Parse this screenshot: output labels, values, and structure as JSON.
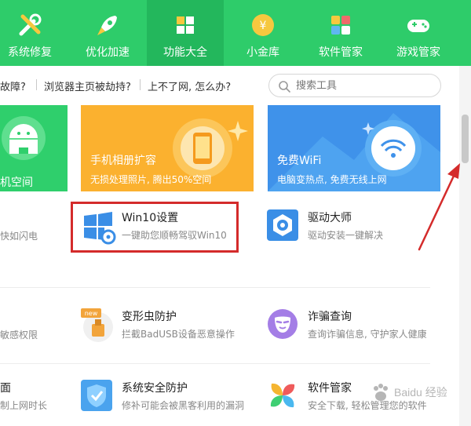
{
  "nav": {
    "items": [
      {
        "label": "系统修复",
        "icon": "tools-icon"
      },
      {
        "label": "优化加速",
        "icon": "rocket-icon"
      },
      {
        "label": "功能大全",
        "icon": "grid-icon"
      },
      {
        "label": "小金库",
        "icon": "coin-icon"
      },
      {
        "label": "软件管家",
        "icon": "app-store-icon"
      },
      {
        "label": "游戏管家",
        "icon": "gamepad-icon"
      }
    ],
    "active_index": 2
  },
  "hotlinks": [
    "故障?",
    "浏览器主页被劫持?",
    "上不了网, 怎么办?"
  ],
  "search": {
    "placeholder": "搜索工具"
  },
  "banners": [
    {
      "title": "机空间",
      "subtitle": "",
      "icon": "android-icon"
    },
    {
      "title": "手机相册扩容",
      "subtitle": "无损处理照片, 腾出50%空间",
      "icon": "phone-icon"
    },
    {
      "title": "免费WiFi",
      "subtitle": "电脑变热点, 免费无线上网",
      "icon": "wifi-icon"
    }
  ],
  "rows": {
    "row1": {
      "left_cut_desc": "快如闪电",
      "col2": {
        "title": "Win10设置",
        "desc": "一键助您顺畅驾驭Win10",
        "icon": "windows-settings-icon"
      },
      "col3": {
        "title": "驱动大师",
        "desc": "驱动安装一键解决",
        "icon": "driver-gear-icon"
      }
    },
    "row2": {
      "left_cut_desc": "敏感权限",
      "col2": {
        "title": "变形虫防护",
        "desc": "拦截BadUSB设备恶意操作",
        "icon": "usb-shield-icon",
        "badge": "new"
      },
      "col3": {
        "title": "诈骗查询",
        "desc": "查询诈骗信息, 守护家人健康",
        "icon": "mask-icon"
      }
    },
    "row3": {
      "left_cut_title": "面",
      "left_cut_desc": "制上网时长",
      "col2": {
        "title": "系统安全防护",
        "desc": "修补可能会被黑客利用的漏洞",
        "icon": "shield-icon"
      },
      "col3": {
        "title": "软件管家",
        "desc": "安全下载, 轻松管理您的软件",
        "icon": "app-store-icon"
      }
    }
  },
  "watermark": {
    "text": "Baidu 经验"
  },
  "colors": {
    "nav_green": "#2ecc6a",
    "highlight_red": "#d42b2b",
    "banner_orange": "#fbb12f",
    "banner_blue": "#3f92ea"
  }
}
